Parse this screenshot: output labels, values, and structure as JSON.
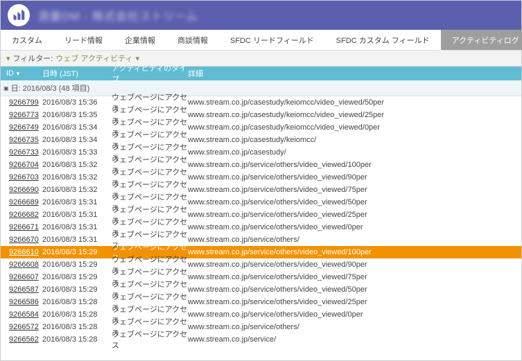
{
  "header": {
    "title": "測量DM - 株式会社ストリーム"
  },
  "tabs": [
    {
      "label": "カスタム",
      "active": false
    },
    {
      "label": "リード情報",
      "active": false
    },
    {
      "label": "企業情報",
      "active": false
    },
    {
      "label": "商談情報",
      "active": false
    },
    {
      "label": "SFDC リードフィールド",
      "active": false
    },
    {
      "label": "SFDC カスタム フィールド",
      "active": false
    },
    {
      "label": "アクティビティログ",
      "active": true
    }
  ],
  "filter": {
    "label": "フィルター:",
    "value": "ウェブ アクティビティ"
  },
  "columns": {
    "id": "ID",
    "date": "日時 (JST)",
    "type": "アクティビティのタイプ",
    "detail": "詳細"
  },
  "group": {
    "label": "日: 2016/08/3 (48 項目)"
  },
  "selectedId": "9266610",
  "rows": [
    {
      "id": "9266799",
      "date": "2016/08/3 15:36",
      "type": "ウェブページにアクセス",
      "detail": "www.stream.co.jp/casestudy/keiomcc/video_viewed/50per"
    },
    {
      "id": "9266773",
      "date": "2016/08/3 15:35",
      "type": "ウェブページにアクセス",
      "detail": "www.stream.co.jp/casestudy/keiomcc/video_viewed/25per"
    },
    {
      "id": "9266749",
      "date": "2016/08/3 15:34",
      "type": "ウェブページにアクセス",
      "detail": "www.stream.co.jp/casestudy/keiomcc/video_viewed/0per"
    },
    {
      "id": "9266735",
      "date": "2016/08/3 15:34",
      "type": "ウェブページにアクセス",
      "detail": "www.stream.co.jp/casestudy/keiomcc/"
    },
    {
      "id": "9266733",
      "date": "2016/08/3 15:33",
      "type": "ウェブページにアクセス",
      "detail": "www.stream.co.jp/casestudy/"
    },
    {
      "id": "9266704",
      "date": "2016/08/3 15:32",
      "type": "ウェブページにアクセス",
      "detail": "www.stream.co.jp/service/others/video_viewed/100per"
    },
    {
      "id": "9266703",
      "date": "2016/08/3 15:32",
      "type": "ウェブページにアクセス",
      "detail": "www.stream.co.jp/service/others/video_viewed/90per"
    },
    {
      "id": "9266690",
      "date": "2016/08/3 15:32",
      "type": "ウェブページにアクセス",
      "detail": "www.stream.co.jp/service/others/video_viewed/75per"
    },
    {
      "id": "9266689",
      "date": "2016/08/3 15:31",
      "type": "ウェブページにアクセス",
      "detail": "www.stream.co.jp/service/others/video_viewed/50per"
    },
    {
      "id": "9266682",
      "date": "2016/08/3 15:31",
      "type": "ウェブページにアクセス",
      "detail": "www.stream.co.jp/service/others/video_viewed/25per"
    },
    {
      "id": "9266671",
      "date": "2016/08/3 15:31",
      "type": "ウェブページにアクセス",
      "detail": "www.stream.co.jp/service/others/video_viewed/0per"
    },
    {
      "id": "9266670",
      "date": "2016/08/3 15:31",
      "type": "ウェブページにアクセス",
      "detail": "www.stream.co.jp/service/others/"
    },
    {
      "id": "9266610",
      "date": "2016/08/3 15:29",
      "type": "ウェブページにアクセス",
      "detail": "www.stream.co.jp/service/others/video_viewed/100per"
    },
    {
      "id": "9266608",
      "date": "2016/08/3 15:29",
      "type": "ウェブページにアクセス",
      "detail": "www.stream.co.jp/service/others/video_viewed/90per"
    },
    {
      "id": "9266607",
      "date": "2016/08/3 15:29",
      "type": "ウェブページにアクセス",
      "detail": "www.stream.co.jp/service/others/video_viewed/75per"
    },
    {
      "id": "9266587",
      "date": "2016/08/3 15:29",
      "type": "ウェブページにアクセス",
      "detail": "www.stream.co.jp/service/others/video_viewed/50per"
    },
    {
      "id": "9266586",
      "date": "2016/08/3 15:28",
      "type": "ウェブページにアクセス",
      "detail": "www.stream.co.jp/service/others/video_viewed/25per"
    },
    {
      "id": "9266584",
      "date": "2016/08/3 15:28",
      "type": "ウェブページにアクセス",
      "detail": "www.stream.co.jp/service/others/video_viewed/0per"
    },
    {
      "id": "9266572",
      "date": "2016/08/3 15:28",
      "type": "ウェブページにアクセス",
      "detail": "www.stream.co.jp/service/others/"
    },
    {
      "id": "9266562",
      "date": "2016/08/3 15:28",
      "type": "ウェブページにアクセス",
      "detail": "www.stream.co.jp/service/"
    }
  ]
}
